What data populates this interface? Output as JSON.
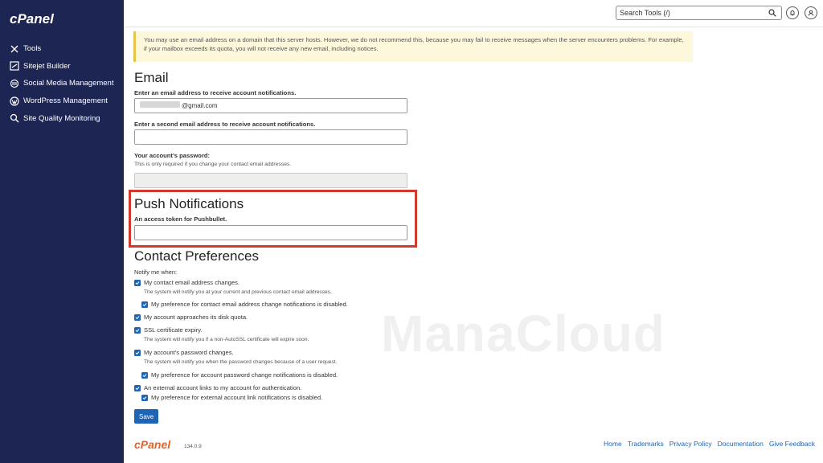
{
  "sidebar": {
    "brand": "cPanel",
    "items": [
      {
        "label": "Tools",
        "icon": "tools-icon"
      },
      {
        "label": "Sitejet Builder",
        "icon": "sitejet-icon"
      },
      {
        "label": "Social Media Management",
        "icon": "social-icon"
      },
      {
        "label": "WordPress Management",
        "icon": "wordpress-icon"
      },
      {
        "label": "Site Quality Monitoring",
        "icon": "search-icon"
      }
    ]
  },
  "header": {
    "search_placeholder": "Search Tools (/)"
  },
  "warning": {
    "text": "You may use an email address on a domain that this server hosts. However, we do not recommend this, because you may fail to receive messages when the server encounters problems. For example, if your mailbox exceeds its quota, you will not receive any new email, including notices."
  },
  "email": {
    "title": "Email",
    "label1": "Enter an email address to receive account notifications.",
    "value1": "@gmail.com",
    "label2": "Enter a second email address to receive account notifications.",
    "value2": "",
    "password_label": "Your account's password:",
    "password_help": "This is only required if you change your contact email addresses."
  },
  "push": {
    "title": "Push Notifications",
    "label": "An access token for Pushbullet.",
    "value": ""
  },
  "contact": {
    "title": "Contact Preferences",
    "notify_label": "Notify me when:",
    "items": [
      {
        "label": "My contact email address changes.",
        "note": "The system will notify you at your current and previous contact email addresses."
      },
      {
        "label": "My preference for contact email address change notifications is disabled."
      },
      {
        "label": "My account approaches its disk quota."
      },
      {
        "label": "SSL certificate expiry.",
        "note": "The system will notify you if a non-AutoSSL certificate will expire soon."
      },
      {
        "label": "My account's password changes.",
        "note": "The system will notify you when the password changes because of a user request."
      },
      {
        "label": "My preference for account password change notifications is disabled."
      },
      {
        "label": "An external account links to my account for authentication."
      },
      {
        "label": "My preference for external account link notifications is disabled."
      }
    ]
  },
  "save_label": "Save",
  "footer": {
    "brand": "cPanel",
    "version": "134.0.9",
    "links": [
      "Home",
      "Trademarks",
      "Privacy Policy",
      "Documentation",
      "Give Feedback"
    ]
  },
  "watermark": "ManaCloud",
  "colors": {
    "sidebar": "#1d2653",
    "accent": "#1f63b6",
    "highlight": "#d0392b",
    "warning_bg": "#fdf8dc"
  }
}
